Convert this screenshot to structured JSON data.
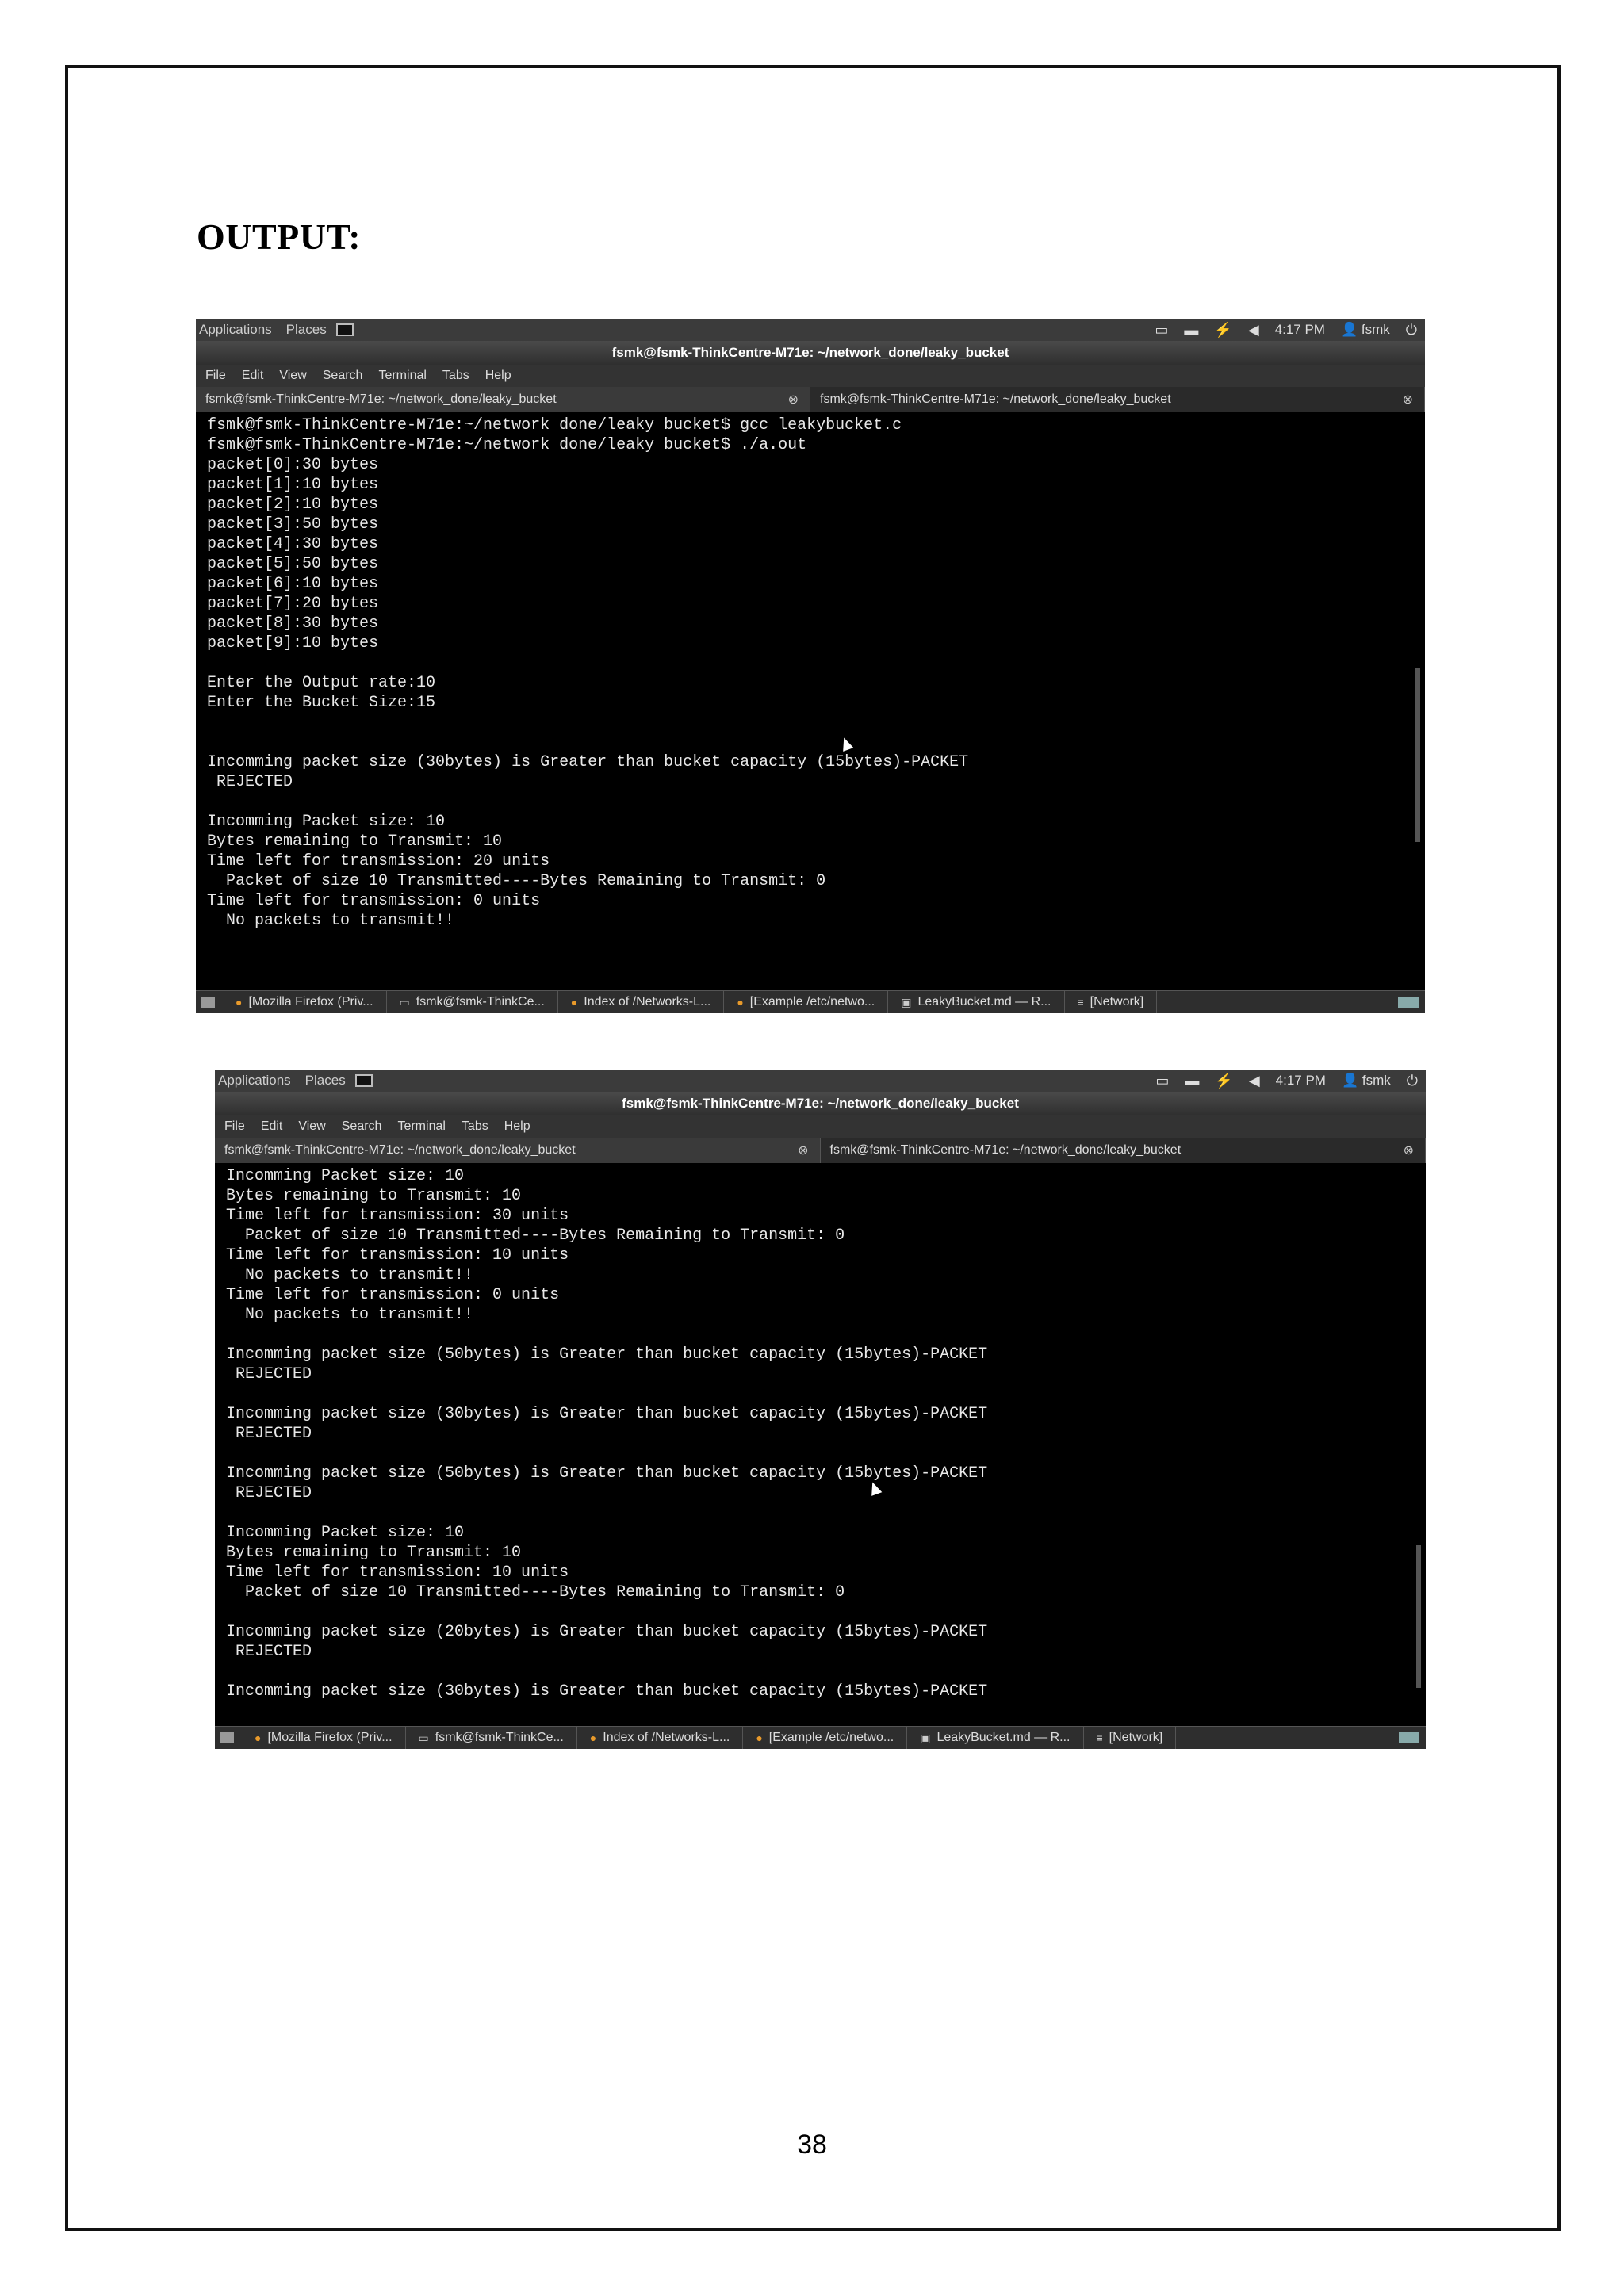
{
  "heading": "OUTPUT:",
  "page_number": "38",
  "colors": {
    "page_bg": "#ffffff",
    "terminal_bg": "#000000",
    "terminal_fg": "#e8e8e8",
    "panel_bg": "#3b3b3b"
  },
  "screens": [
    {
      "topbar": {
        "applications": "Applications",
        "places": "Places",
        "clock": "4:17 PM",
        "user": "fsmk",
        "icons": [
          "monitor-icon",
          "keyboard-icon",
          "network-icon",
          "speaker-icon",
          "power-icon"
        ]
      },
      "window_title": "fsmk@fsmk-ThinkCentre-M71e: ~/network_done/leaky_bucket",
      "menu": [
        "File",
        "Edit",
        "View",
        "Search",
        "Terminal",
        "Tabs",
        "Help"
      ],
      "tabs": [
        "fsmk@fsmk-ThinkCentre-M71e: ~/network_done/leaky_bucket",
        "fsmk@fsmk-ThinkCentre-M71e: ~/network_done/leaky_bucket"
      ],
      "terminal_lines": [
        "fsmk@fsmk-ThinkCentre-M71e:~/network_done/leaky_bucket$ gcc leakybucket.c",
        "fsmk@fsmk-ThinkCentre-M71e:~/network_done/leaky_bucket$ ./a.out",
        "packet[0]:30 bytes",
        "packet[1]:10 bytes",
        "packet[2]:10 bytes",
        "packet[3]:50 bytes",
        "packet[4]:30 bytes",
        "packet[5]:50 bytes",
        "packet[6]:10 bytes",
        "packet[7]:20 bytes",
        "packet[8]:30 bytes",
        "packet[9]:10 bytes",
        "",
        "Enter the Output rate:10",
        "Enter the Bucket Size:15",
        "",
        "",
        "Incomming packet size (30bytes) is Greater than bucket capacity (15bytes)-PACKET",
        " REJECTED",
        "",
        "Incomming Packet size: 10",
        "Bytes remaining to Transmit: 10",
        "Time left for transmission: 20 units",
        "  Packet of size 10 Transmitted----Bytes Remaining to Transmit: 0",
        "Time left for transmission: 0 units",
        "  No packets to transmit!!"
      ],
      "taskbar": [
        "[Mozilla Firefox (Priv...",
        "fsmk@fsmk-ThinkCe...",
        "Index of /Networks-L...",
        "[Example /etc/netwo...",
        "LeakyBucket.md — R...",
        "[Network]"
      ]
    },
    {
      "topbar": {
        "applications": "Applications",
        "places": "Places",
        "clock": "4:17 PM",
        "user": "fsmk",
        "icons": [
          "monitor-icon",
          "keyboard-icon",
          "network-icon",
          "speaker-icon",
          "power-icon"
        ]
      },
      "window_title": "fsmk@fsmk-ThinkCentre-M71e: ~/network_done/leaky_bucket",
      "menu": [
        "File",
        "Edit",
        "View",
        "Search",
        "Terminal",
        "Tabs",
        "Help"
      ],
      "tabs": [
        "fsmk@fsmk-ThinkCentre-M71e: ~/network_done/leaky_bucket",
        "fsmk@fsmk-ThinkCentre-M71e: ~/network_done/leaky_bucket"
      ],
      "terminal_lines": [
        "Incomming Packet size: 10",
        "Bytes remaining to Transmit: 10",
        "Time left for transmission: 30 units",
        "  Packet of size 10 Transmitted----Bytes Remaining to Transmit: 0",
        "Time left for transmission: 10 units",
        "  No packets to transmit!!",
        "Time left for transmission: 0 units",
        "  No packets to transmit!!",
        "",
        "Incomming packet size (50bytes) is Greater than bucket capacity (15bytes)-PACKET",
        " REJECTED",
        "",
        "Incomming packet size (30bytes) is Greater than bucket capacity (15bytes)-PACKET",
        " REJECTED",
        "",
        "Incomming packet size (50bytes) is Greater than bucket capacity (15bytes)-PACKET",
        " REJECTED",
        "",
        "Incomming Packet size: 10",
        "Bytes remaining to Transmit: 10",
        "Time left for transmission: 10 units",
        "  Packet of size 10 Transmitted----Bytes Remaining to Transmit: 0",
        "",
        "Incomming packet size (20bytes) is Greater than bucket capacity (15bytes)-PACKET",
        " REJECTED",
        "",
        "Incomming packet size (30bytes) is Greater than bucket capacity (15bytes)-PACKET"
      ],
      "taskbar": [
        "[Mozilla Firefox (Priv...",
        "fsmk@fsmk-ThinkCe...",
        "Index of /Networks-L...",
        "[Example /etc/netwo...",
        "LeakyBucket.md — R...",
        "[Network]"
      ]
    }
  ]
}
